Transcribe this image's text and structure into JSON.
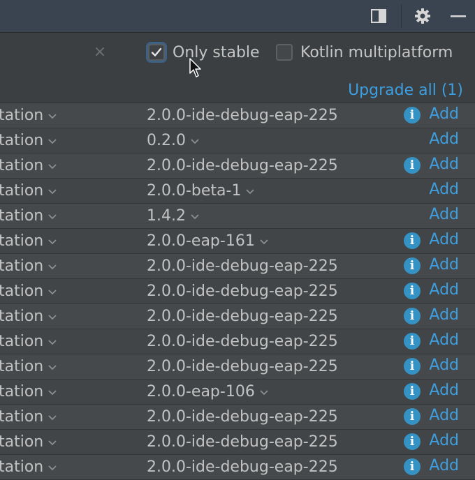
{
  "toolbar": {
    "icons": [
      "panel-layout-icon",
      "gear-icon",
      "minimize-icon"
    ]
  },
  "filters": {
    "clear_icon": "×",
    "only_stable": {
      "label": "Only stable",
      "checked": true
    },
    "kotlin_multiplatform": {
      "label": "Kotlin multiplatform",
      "checked": false
    },
    "upgrade_all": "Upgrade all (1)"
  },
  "table": {
    "rows": [
      {
        "name": "tation",
        "version": "2.0.0-ide-debug-eap-225",
        "has_info": true,
        "action": "Add"
      },
      {
        "name": "tation",
        "version": "0.2.0",
        "has_info": false,
        "action": "Add",
        "dropdown": true
      },
      {
        "name": "tation",
        "version": "2.0.0-ide-debug-eap-225",
        "has_info": true,
        "action": "Add"
      },
      {
        "name": "tation",
        "version": "2.0.0-beta-1",
        "has_info": false,
        "action": "Add",
        "dropdown": true
      },
      {
        "name": "tation",
        "version": "1.4.2",
        "has_info": false,
        "action": "Add",
        "dropdown": true
      },
      {
        "name": "tation",
        "version": "2.0.0-eap-161",
        "has_info": true,
        "action": "Add",
        "dropdown": true
      },
      {
        "name": "tation",
        "version": "2.0.0-ide-debug-eap-225",
        "has_info": true,
        "action": "Add"
      },
      {
        "name": "tation",
        "version": "2.0.0-ide-debug-eap-225",
        "has_info": true,
        "action": "Add"
      },
      {
        "name": "tation",
        "version": "2.0.0-ide-debug-eap-225",
        "has_info": true,
        "action": "Add"
      },
      {
        "name": "tation",
        "version": "2.0.0-ide-debug-eap-225",
        "has_info": true,
        "action": "Add"
      },
      {
        "name": "tation",
        "version": "2.0.0-ide-debug-eap-225",
        "has_info": true,
        "action": "Add"
      },
      {
        "name": "tation",
        "version": "2.0.0-eap-106",
        "has_info": true,
        "action": "Add",
        "dropdown": true
      },
      {
        "name": "tation",
        "version": "2.0.0-ide-debug-eap-225",
        "has_info": true,
        "action": "Add"
      },
      {
        "name": "tation",
        "version": "2.0.0-ide-debug-eap-225",
        "has_info": true,
        "action": "Add"
      },
      {
        "name": "tation",
        "version": "2.0.0-ide-debug-eap-225",
        "has_info": true,
        "action": "Add"
      }
    ]
  },
  "colors": {
    "accent": "#3d9fe0",
    "info_icon": "#3592c4",
    "background": "#3c3f41",
    "toolbar": "#3a4450"
  }
}
